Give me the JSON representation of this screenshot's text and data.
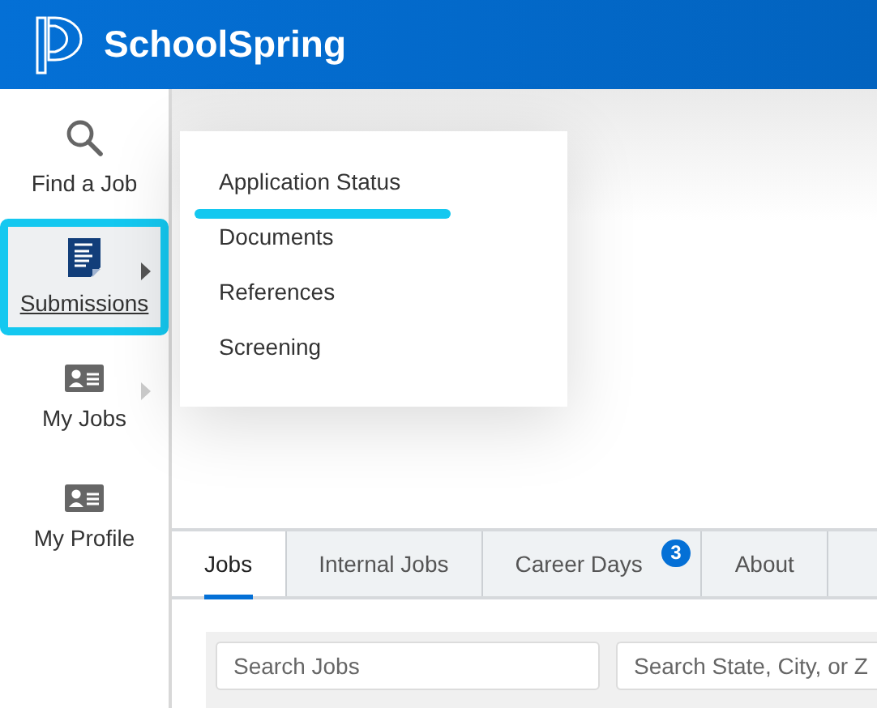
{
  "header": {
    "brand": "SchoolSpring"
  },
  "sidebar": {
    "items": [
      {
        "kind": "search",
        "label": "Find a Job",
        "selected": false,
        "has_submenu": false
      },
      {
        "kind": "document",
        "label": "Submissions",
        "selected": true,
        "has_submenu": true
      },
      {
        "kind": "card",
        "label": "My Jobs",
        "selected": false,
        "has_submenu": true
      },
      {
        "kind": "card",
        "label": "My Profile",
        "selected": false,
        "has_submenu": false
      }
    ]
  },
  "submenu": {
    "items": [
      {
        "label": "Application Status",
        "selected": true
      },
      {
        "label": "Documents",
        "selected": false
      },
      {
        "label": "References",
        "selected": false
      },
      {
        "label": "Screening",
        "selected": false
      }
    ]
  },
  "tabs": [
    {
      "label": "Jobs",
      "selected": true
    },
    {
      "label": "Internal Jobs",
      "selected": false
    },
    {
      "label": "Career Days",
      "selected": false,
      "badge": "3"
    },
    {
      "label": "About",
      "selected": false
    }
  ],
  "search": {
    "fields": [
      {
        "placeholder": "Search Jobs"
      },
      {
        "placeholder": "Search State, City, or Z"
      }
    ]
  }
}
